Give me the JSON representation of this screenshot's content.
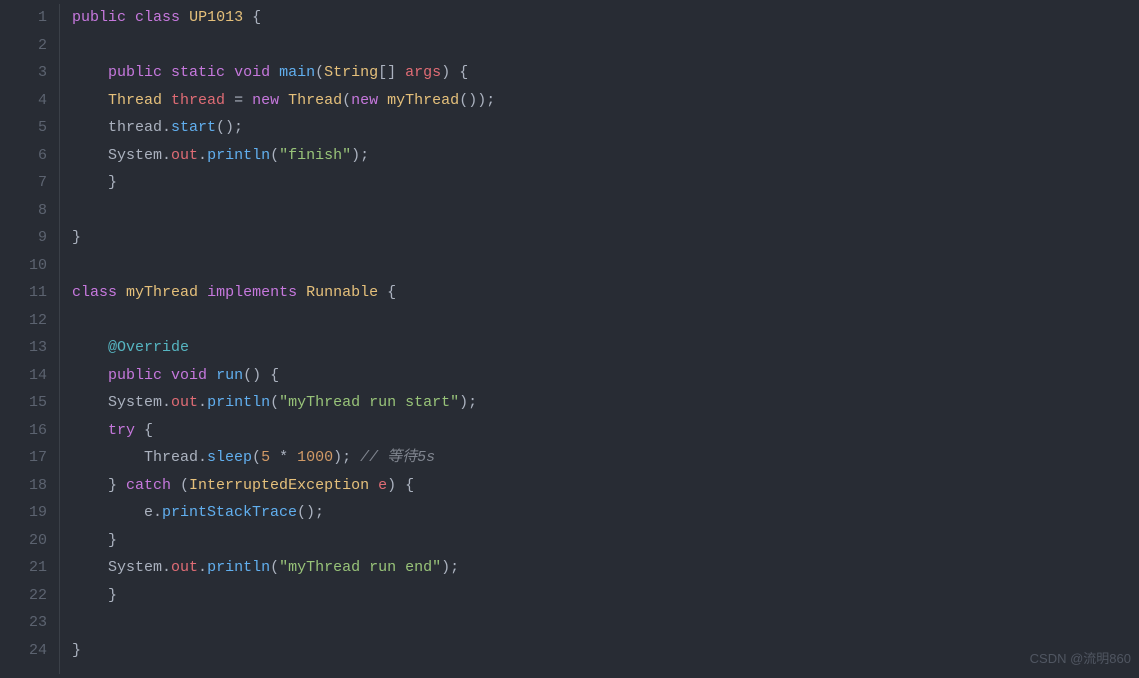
{
  "editor": {
    "language": "java",
    "line_count": 24,
    "lines": [
      {
        "n": 1,
        "tokens": [
          [
            "kw-purple",
            "public"
          ],
          [
            "plain",
            " "
          ],
          [
            "kw-purple",
            "class"
          ],
          [
            "plain",
            " "
          ],
          [
            "type-yellow",
            "UP1013"
          ],
          [
            "plain",
            " {"
          ]
        ]
      },
      {
        "n": 2,
        "tokens": []
      },
      {
        "n": 3,
        "tokens": [
          [
            "plain",
            "    "
          ],
          [
            "kw-purple",
            "public"
          ],
          [
            "plain",
            " "
          ],
          [
            "kw-purple",
            "static"
          ],
          [
            "plain",
            " "
          ],
          [
            "kw-purple",
            "void"
          ],
          [
            "plain",
            " "
          ],
          [
            "fn-blue",
            "main"
          ],
          [
            "plain",
            "("
          ],
          [
            "type-yellow",
            "String"
          ],
          [
            "plain",
            "[] "
          ],
          [
            "var-red",
            "args"
          ],
          [
            "plain",
            ") {"
          ]
        ]
      },
      {
        "n": 4,
        "tokens": [
          [
            "plain",
            "    "
          ],
          [
            "type-yellow",
            "Thread"
          ],
          [
            "plain",
            " "
          ],
          [
            "var-red",
            "thread"
          ],
          [
            "plain",
            " = "
          ],
          [
            "kw-purple",
            "new"
          ],
          [
            "plain",
            " "
          ],
          [
            "type-yellow",
            "Thread"
          ],
          [
            "plain",
            "("
          ],
          [
            "kw-purple",
            "new"
          ],
          [
            "plain",
            " "
          ],
          [
            "type-yellow",
            "myThread"
          ],
          [
            "plain",
            "());"
          ]
        ]
      },
      {
        "n": 5,
        "tokens": [
          [
            "plain",
            "    thread."
          ],
          [
            "fn-blue",
            "start"
          ],
          [
            "plain",
            "();"
          ]
        ]
      },
      {
        "n": 6,
        "tokens": [
          [
            "plain",
            "    System."
          ],
          [
            "var-red",
            "out"
          ],
          [
            "plain",
            "."
          ],
          [
            "fn-blue",
            "println"
          ],
          [
            "plain",
            "("
          ],
          [
            "string",
            "\"finish\""
          ],
          [
            "plain",
            ");"
          ]
        ]
      },
      {
        "n": 7,
        "tokens": [
          [
            "plain",
            "    }"
          ]
        ]
      },
      {
        "n": 8,
        "tokens": []
      },
      {
        "n": 9,
        "tokens": [
          [
            "plain",
            "}"
          ]
        ]
      },
      {
        "n": 10,
        "tokens": []
      },
      {
        "n": 11,
        "tokens": [
          [
            "kw-purple",
            "class"
          ],
          [
            "plain",
            " "
          ],
          [
            "type-yellow",
            "myThread"
          ],
          [
            "plain",
            " "
          ],
          [
            "kw-purple",
            "implements"
          ],
          [
            "plain",
            " "
          ],
          [
            "type-yellow",
            "Runnable"
          ],
          [
            "plain",
            " {"
          ]
        ]
      },
      {
        "n": 12,
        "tokens": []
      },
      {
        "n": 13,
        "tokens": [
          [
            "plain",
            "    "
          ],
          [
            "fn-teal",
            "@Override"
          ]
        ]
      },
      {
        "n": 14,
        "tokens": [
          [
            "plain",
            "    "
          ],
          [
            "kw-purple",
            "public"
          ],
          [
            "plain",
            " "
          ],
          [
            "kw-purple",
            "void"
          ],
          [
            "plain",
            " "
          ],
          [
            "fn-blue",
            "run"
          ],
          [
            "plain",
            "() {"
          ]
        ]
      },
      {
        "n": 15,
        "tokens": [
          [
            "plain",
            "    System."
          ],
          [
            "var-red",
            "out"
          ],
          [
            "plain",
            "."
          ],
          [
            "fn-blue",
            "println"
          ],
          [
            "plain",
            "("
          ],
          [
            "string",
            "\"myThread run start\""
          ],
          [
            "plain",
            ");"
          ]
        ]
      },
      {
        "n": 16,
        "tokens": [
          [
            "plain",
            "    "
          ],
          [
            "kw-purple",
            "try"
          ],
          [
            "plain",
            " {"
          ]
        ]
      },
      {
        "n": 17,
        "tokens": [
          [
            "plain",
            "        Thread."
          ],
          [
            "fn-blue",
            "sleep"
          ],
          [
            "plain",
            "("
          ],
          [
            "num",
            "5"
          ],
          [
            "plain",
            " * "
          ],
          [
            "num",
            "1000"
          ],
          [
            "plain",
            "); "
          ],
          [
            "comment",
            "// 等待5s"
          ]
        ]
      },
      {
        "n": 18,
        "tokens": [
          [
            "plain",
            "    } "
          ],
          [
            "kw-purple",
            "catch"
          ],
          [
            "plain",
            " ("
          ],
          [
            "type-yellow",
            "InterruptedException"
          ],
          [
            "plain",
            " "
          ],
          [
            "var-red",
            "e"
          ],
          [
            "plain",
            ") {"
          ]
        ]
      },
      {
        "n": 19,
        "tokens": [
          [
            "plain",
            "        e."
          ],
          [
            "fn-blue",
            "printStackTrace"
          ],
          [
            "plain",
            "();"
          ]
        ]
      },
      {
        "n": 20,
        "tokens": [
          [
            "plain",
            "    }"
          ]
        ]
      },
      {
        "n": 21,
        "tokens": [
          [
            "plain",
            "    System."
          ],
          [
            "var-red",
            "out"
          ],
          [
            "plain",
            "."
          ],
          [
            "fn-blue",
            "println"
          ],
          [
            "plain",
            "("
          ],
          [
            "string",
            "\"myThread run end\""
          ],
          [
            "plain",
            ");"
          ]
        ]
      },
      {
        "n": 22,
        "tokens": [
          [
            "plain",
            "    }"
          ]
        ]
      },
      {
        "n": 23,
        "tokens": []
      },
      {
        "n": 24,
        "tokens": [
          [
            "plain",
            "}"
          ]
        ]
      }
    ]
  },
  "watermark": "CSDN @流明860"
}
